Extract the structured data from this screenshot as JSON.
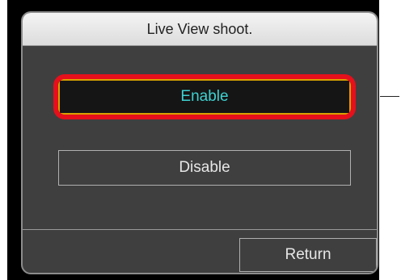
{
  "dialog": {
    "title": "Live View shoot.",
    "options": {
      "enable_label": "Enable",
      "disable_label": "Disable"
    },
    "return_label": "Return"
  },
  "colors": {
    "panel_background": "#3f3f3f",
    "title_bar": "#e8e8e8",
    "selected_text": "#3fd0d0",
    "selected_border": "#d9a100",
    "callout_highlight": "#e5101b"
  }
}
